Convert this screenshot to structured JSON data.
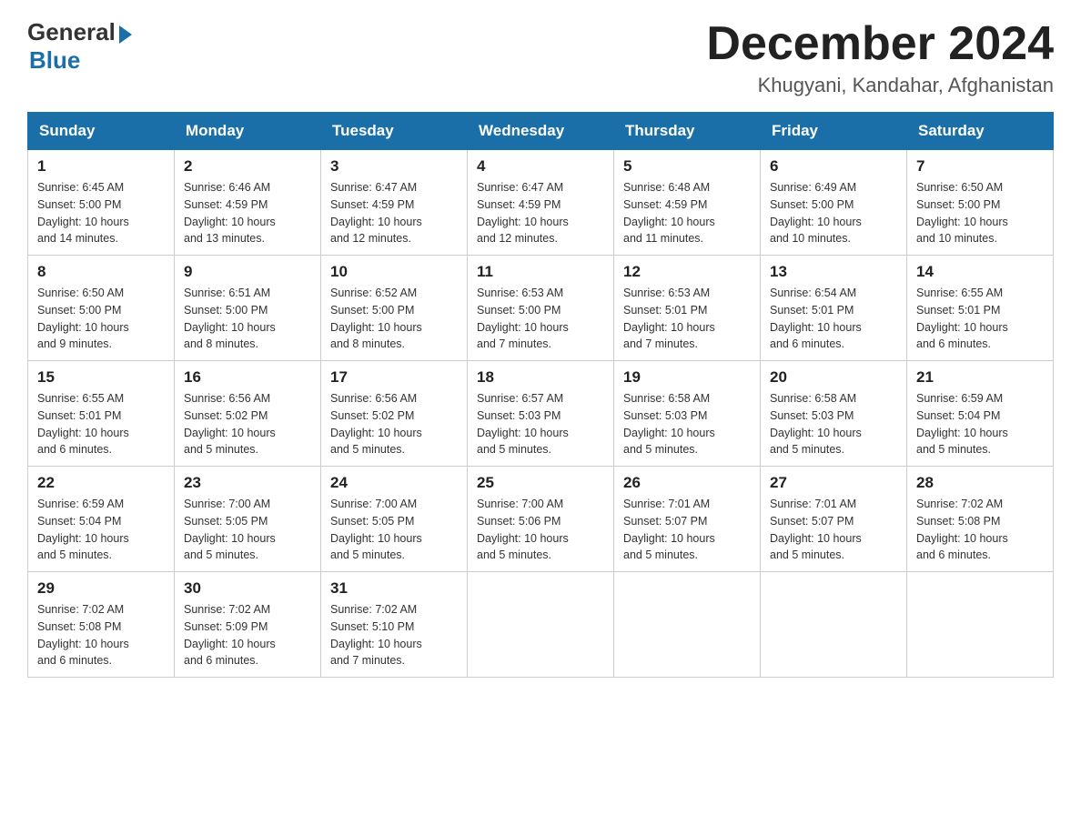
{
  "logo": {
    "general": "General",
    "blue": "Blue"
  },
  "title": {
    "month_year": "December 2024",
    "location": "Khugyani, Kandahar, Afghanistan"
  },
  "headers": [
    "Sunday",
    "Monday",
    "Tuesday",
    "Wednesday",
    "Thursday",
    "Friday",
    "Saturday"
  ],
  "weeks": [
    [
      {
        "day": "1",
        "sunrise": "6:45 AM",
        "sunset": "5:00 PM",
        "daylight": "10 hours and 14 minutes."
      },
      {
        "day": "2",
        "sunrise": "6:46 AM",
        "sunset": "4:59 PM",
        "daylight": "10 hours and 13 minutes."
      },
      {
        "day": "3",
        "sunrise": "6:47 AM",
        "sunset": "4:59 PM",
        "daylight": "10 hours and 12 minutes."
      },
      {
        "day": "4",
        "sunrise": "6:47 AM",
        "sunset": "4:59 PM",
        "daylight": "10 hours and 12 minutes."
      },
      {
        "day": "5",
        "sunrise": "6:48 AM",
        "sunset": "4:59 PM",
        "daylight": "10 hours and 11 minutes."
      },
      {
        "day": "6",
        "sunrise": "6:49 AM",
        "sunset": "5:00 PM",
        "daylight": "10 hours and 10 minutes."
      },
      {
        "day": "7",
        "sunrise": "6:50 AM",
        "sunset": "5:00 PM",
        "daylight": "10 hours and 10 minutes."
      }
    ],
    [
      {
        "day": "8",
        "sunrise": "6:50 AM",
        "sunset": "5:00 PM",
        "daylight": "10 hours and 9 minutes."
      },
      {
        "day": "9",
        "sunrise": "6:51 AM",
        "sunset": "5:00 PM",
        "daylight": "10 hours and 8 minutes."
      },
      {
        "day": "10",
        "sunrise": "6:52 AM",
        "sunset": "5:00 PM",
        "daylight": "10 hours and 8 minutes."
      },
      {
        "day": "11",
        "sunrise": "6:53 AM",
        "sunset": "5:00 PM",
        "daylight": "10 hours and 7 minutes."
      },
      {
        "day": "12",
        "sunrise": "6:53 AM",
        "sunset": "5:01 PM",
        "daylight": "10 hours and 7 minutes."
      },
      {
        "day": "13",
        "sunrise": "6:54 AM",
        "sunset": "5:01 PM",
        "daylight": "10 hours and 6 minutes."
      },
      {
        "day": "14",
        "sunrise": "6:55 AM",
        "sunset": "5:01 PM",
        "daylight": "10 hours and 6 minutes."
      }
    ],
    [
      {
        "day": "15",
        "sunrise": "6:55 AM",
        "sunset": "5:01 PM",
        "daylight": "10 hours and 6 minutes."
      },
      {
        "day": "16",
        "sunrise": "6:56 AM",
        "sunset": "5:02 PM",
        "daylight": "10 hours and 5 minutes."
      },
      {
        "day": "17",
        "sunrise": "6:56 AM",
        "sunset": "5:02 PM",
        "daylight": "10 hours and 5 minutes."
      },
      {
        "day": "18",
        "sunrise": "6:57 AM",
        "sunset": "5:03 PM",
        "daylight": "10 hours and 5 minutes."
      },
      {
        "day": "19",
        "sunrise": "6:58 AM",
        "sunset": "5:03 PM",
        "daylight": "10 hours and 5 minutes."
      },
      {
        "day": "20",
        "sunrise": "6:58 AM",
        "sunset": "5:03 PM",
        "daylight": "10 hours and 5 minutes."
      },
      {
        "day": "21",
        "sunrise": "6:59 AM",
        "sunset": "5:04 PM",
        "daylight": "10 hours and 5 minutes."
      }
    ],
    [
      {
        "day": "22",
        "sunrise": "6:59 AM",
        "sunset": "5:04 PM",
        "daylight": "10 hours and 5 minutes."
      },
      {
        "day": "23",
        "sunrise": "7:00 AM",
        "sunset": "5:05 PM",
        "daylight": "10 hours and 5 minutes."
      },
      {
        "day": "24",
        "sunrise": "7:00 AM",
        "sunset": "5:05 PM",
        "daylight": "10 hours and 5 minutes."
      },
      {
        "day": "25",
        "sunrise": "7:00 AM",
        "sunset": "5:06 PM",
        "daylight": "10 hours and 5 minutes."
      },
      {
        "day": "26",
        "sunrise": "7:01 AM",
        "sunset": "5:07 PM",
        "daylight": "10 hours and 5 minutes."
      },
      {
        "day": "27",
        "sunrise": "7:01 AM",
        "sunset": "5:07 PM",
        "daylight": "10 hours and 5 minutes."
      },
      {
        "day": "28",
        "sunrise": "7:02 AM",
        "sunset": "5:08 PM",
        "daylight": "10 hours and 6 minutes."
      }
    ],
    [
      {
        "day": "29",
        "sunrise": "7:02 AM",
        "sunset": "5:08 PM",
        "daylight": "10 hours and 6 minutes."
      },
      {
        "day": "30",
        "sunrise": "7:02 AM",
        "sunset": "5:09 PM",
        "daylight": "10 hours and 6 minutes."
      },
      {
        "day": "31",
        "sunrise": "7:02 AM",
        "sunset": "5:10 PM",
        "daylight": "10 hours and 7 minutes."
      },
      null,
      null,
      null,
      null
    ]
  ],
  "labels": {
    "sunrise": "Sunrise:",
    "sunset": "Sunset:",
    "daylight": "Daylight:"
  }
}
